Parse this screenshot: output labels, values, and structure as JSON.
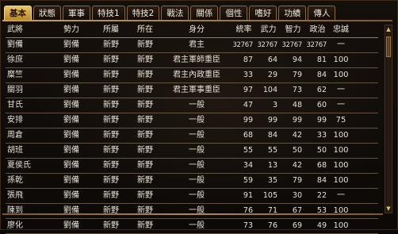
{
  "tabs": [
    "基本",
    "狀態",
    "軍事",
    "特技1",
    "特技2",
    "戰法",
    "關係",
    "個性",
    "嗜好",
    "功績",
    "傳人"
  ],
  "active_tab": 0,
  "columns": [
    "武將",
    "勢力",
    "所屬",
    "所在",
    "身分",
    "統率",
    "武力",
    "智力",
    "政治",
    "忠誠"
  ],
  "rows": [
    [
      "劉備",
      "劉備",
      "新野",
      "新野",
      "君主",
      "32767",
      "32767",
      "32767",
      "32767",
      "一"
    ],
    [
      "徐庶",
      "劉備",
      "新野",
      "新野",
      "君主軍師重臣",
      "87",
      "64",
      "94",
      "81",
      "100"
    ],
    [
      "糜竺",
      "劉備",
      "新野",
      "新野",
      "君主內政重臣",
      "33",
      "29",
      "79",
      "84",
      "100"
    ],
    [
      "關羽",
      "劉備",
      "新野",
      "新野",
      "君主軍事重臣",
      "97",
      "104",
      "73",
      "62",
      "一"
    ],
    [
      "甘氏",
      "劉備",
      "新野",
      "新野",
      "一般",
      "47",
      "3",
      "48",
      "60",
      "一"
    ],
    [
      "安排",
      "劉備",
      "新野",
      "新野",
      "一般",
      "99",
      "99",
      "99",
      "99",
      "75"
    ],
    [
      "周倉",
      "劉備",
      "新野",
      "新野",
      "一般",
      "68",
      "84",
      "42",
      "33",
      "100"
    ],
    [
      "胡班",
      "劉備",
      "新野",
      "新野",
      "一般",
      "55",
      "55",
      "50",
      "50",
      "100"
    ],
    [
      "夏侯氏",
      "劉備",
      "新野",
      "新野",
      "一般",
      "34",
      "13",
      "42",
      "68",
      "100"
    ],
    [
      "孫乾",
      "劉備",
      "新野",
      "新野",
      "一般",
      "59",
      "35",
      "79",
      "84",
      "100"
    ],
    [
      "張飛",
      "劉備",
      "新野",
      "新野",
      "一般",
      "91",
      "105",
      "30",
      "22",
      "一"
    ],
    [
      "陳到",
      "劉備",
      "新野",
      "新野",
      "一般",
      "76",
      "71",
      "67",
      "53",
      "100"
    ],
    [
      "廖化",
      "劉備",
      "新野",
      "新野",
      "一般",
      "73",
      "76",
      "69",
      "49",
      "100"
    ]
  ],
  "scrollbar": {
    "up": "▲",
    "down": "▼"
  },
  "colors": {
    "accent": "#d8b25a",
    "text": "#e8e1d6",
    "background": "#0f0b08"
  }
}
